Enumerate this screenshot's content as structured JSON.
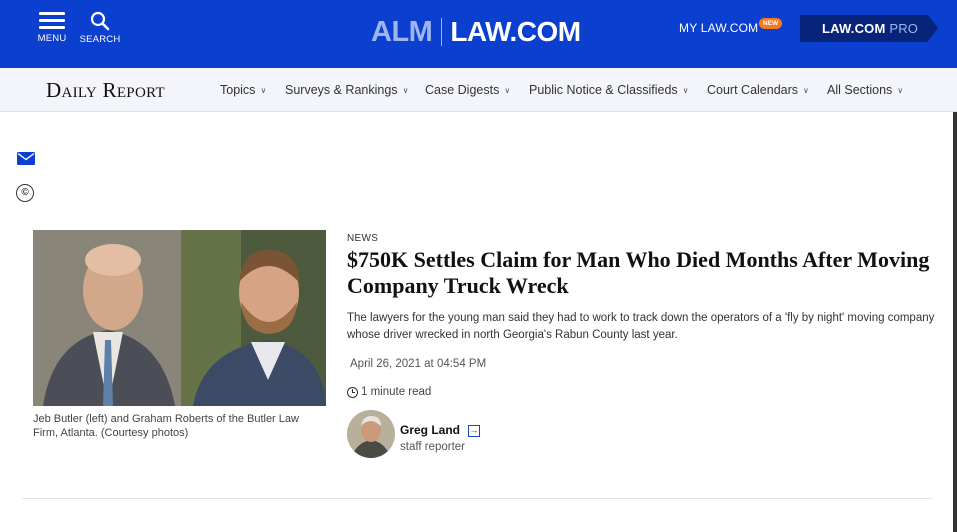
{
  "topbar": {
    "menu_label": "MENU",
    "search_label": "SEARCH",
    "logo_alm": "ALM",
    "logo_law": "LAW.COM",
    "mylaw_label": "MY LAW.COM",
    "new_badge": "NEW",
    "pro_label_main": "LAW.COM",
    "pro_label_suffix": "PRO",
    "bg_color": "#0a3fcf"
  },
  "subnav": {
    "brand": "Daily Report",
    "items": [
      {
        "label": "Topics"
      },
      {
        "label": "Surveys & Rankings"
      },
      {
        "label": "Case Digests"
      },
      {
        "label": "Public Notice & Classifieds"
      },
      {
        "label": "Court Calendars"
      },
      {
        "label": "All Sections"
      }
    ]
  },
  "share": {
    "mail_icon": "envelope-icon",
    "copyright_symbol": "©"
  },
  "article": {
    "kicker": "NEWS",
    "headline": "$750K Settles Claim for Man Who Died Months After Moving Company Truck Wreck",
    "summary": "The lawyers for the young man said they had to work to track down the operators of a 'fly by night' moving company whose driver wrecked in north Georgia's Rabun County last year.",
    "date": "April 26, 2021 at 04:54 PM",
    "read_time": "1 minute read",
    "photo_caption": "Jeb Butler (left) and Graham Roberts of the Butler Law Firm, Atlanta. (Courtesy photos)",
    "author": {
      "name": "Greg Land",
      "role": "staff reporter"
    }
  }
}
